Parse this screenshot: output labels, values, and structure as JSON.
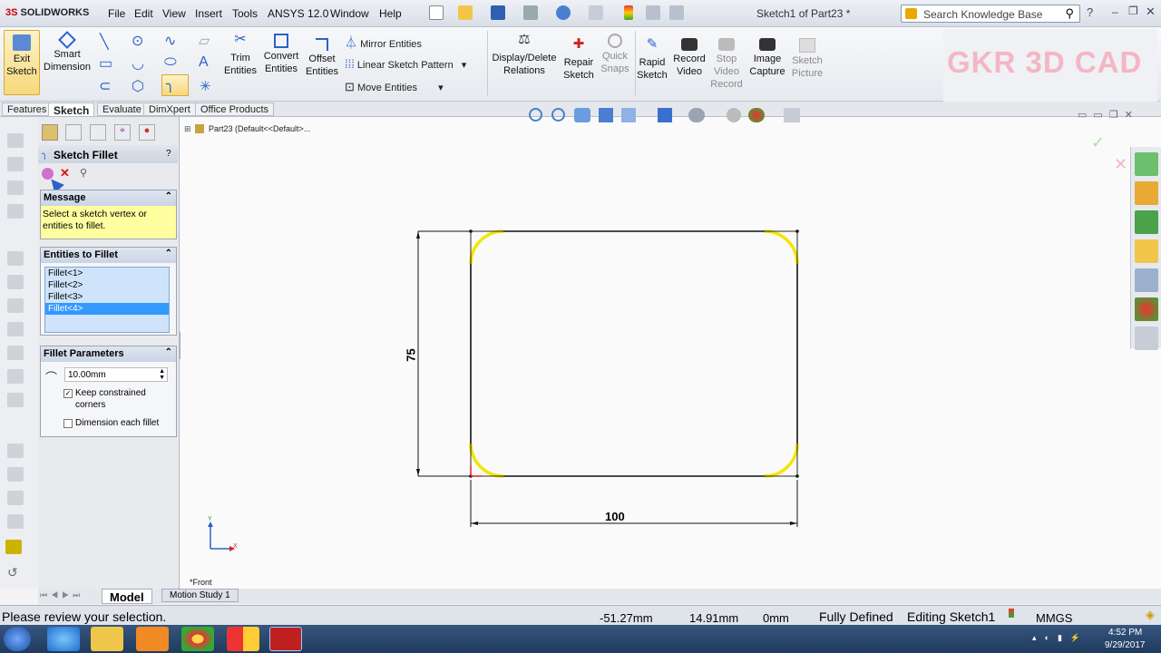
{
  "app": {
    "logo": "SOLIDWORKS",
    "doc_title": "Sketch1 of Part23 *"
  },
  "menu": [
    "File",
    "Edit",
    "View",
    "Insert",
    "Tools",
    "ANSYS 12.0",
    "Window",
    "Help"
  ],
  "search": {
    "placeholder": "Search Knowledge Base"
  },
  "ribbon": {
    "exit_sketch": "Exit Sketch",
    "smart_dimension": "Smart Dimension",
    "trim_entities": "Trim Entities",
    "convert_entities": "Convert Entities",
    "offset_entities": "Offset Entities",
    "mirror_entities": "Mirror Entities",
    "linear_sketch_pattern": "Linear Sketch Pattern",
    "move_entities": "Move Entities",
    "display_delete_relations": "Display/Delete Relations",
    "repair_sketch": "Repair Sketch",
    "quick_snaps": "Quick Snaps",
    "rapid_sketch": "Rapid Sketch",
    "record_video": "Record Video",
    "stop_video_record": "Stop Video Record",
    "image_capture": "Image Capture",
    "sketch_picture": "Sketch Picture"
  },
  "watermark": "GKR 3D CAD",
  "tabs": [
    "Features",
    "Sketch",
    "Evaluate",
    "DimXpert",
    "Office Products"
  ],
  "pm": {
    "title": "Sketch Fillet",
    "ok_tip": "OK",
    "message_title": "Message",
    "message_text": "Select a sketch vertex or entities to fillet.",
    "entities_title": "Entities to Fillet",
    "entities": [
      "Fillet<1>",
      "Fillet<2>",
      "Fillet<3>",
      "Fillet<4>"
    ],
    "params_title": "Fillet Parameters",
    "radius": "10.00mm",
    "keep_corners": "Keep constrained corners",
    "keep_corners_checked": true,
    "dimension_each": "Dimension each fillet",
    "dimension_each_checked": false
  },
  "tree": {
    "root": "Part23  (Default<<Default>..."
  },
  "drawing": {
    "width_dim": "100",
    "height_dim": "75",
    "view_label": "*Front"
  },
  "bottom_tabs": [
    "Model",
    "Motion Study 1"
  ],
  "status": {
    "message": "Please review your selection.",
    "x": "-51.27mm",
    "y": "14.91mm",
    "z": "0mm",
    "defined": "Fully Defined",
    "editing": "Editing Sketch1",
    "units": "MMGS"
  },
  "clock": {
    "time": "4:52 PM",
    "date": "9/29/2017"
  },
  "colors": {
    "fillet": "#f2e600",
    "selection": "#3399ff",
    "message_bg": "#ffffa0"
  }
}
